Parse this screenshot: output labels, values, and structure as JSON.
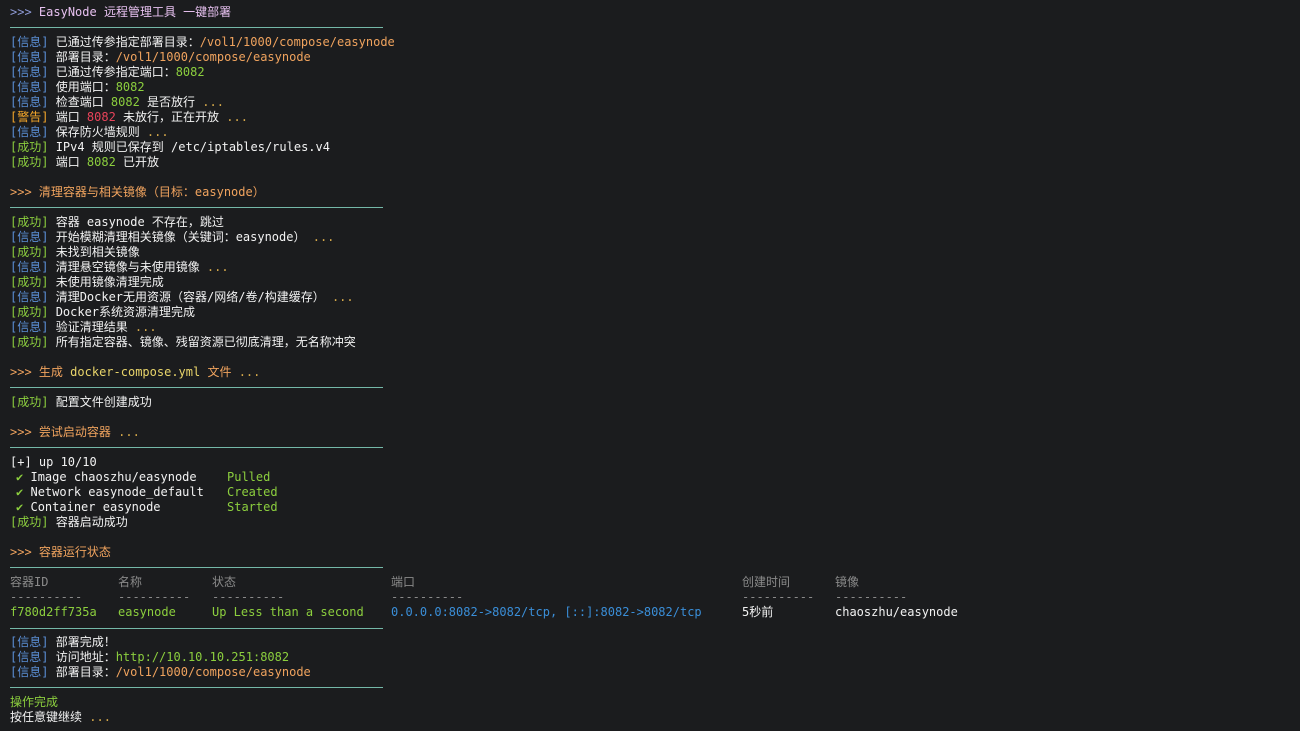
{
  "header": {
    "prompt": ">>>",
    "title": "EasyNode 远程管理工具 一键部署"
  },
  "tags": {
    "info": "[信息]",
    "warn": "[警告]",
    "ok": "[成功]"
  },
  "block1": [
    {
      "tag": "info",
      "pre": "已通过传参指定部署目录：",
      "val": "/vol1/1000/compose/easynode",
      "post": ""
    },
    {
      "tag": "info",
      "pre": "部署目录：",
      "val": "/vol1/1000/compose/easynode",
      "post": ""
    },
    {
      "tag": "info",
      "pre": "已通过传参指定端口：",
      "val": "8082",
      "post": ""
    },
    {
      "tag": "info",
      "pre": "使用端口：",
      "val": "8082",
      "post": ""
    },
    {
      "tag": "info",
      "pre": "检查端口 ",
      "val": "8082",
      "post": " 是否放行 ..."
    },
    {
      "tag": "warn",
      "pre": "端口 ",
      "val": "8082",
      "post": " 未放行，正在开放 ..."
    },
    {
      "tag": "info",
      "pre": "保存防火墙规则 ...",
      "val": "",
      "post": ""
    },
    {
      "tag": "ok",
      "pre": "IPv4 规则已保存到 /etc/iptables/rules.v4",
      "val": "",
      "post": ""
    },
    {
      "tag": "ok",
      "pre": "端口 ",
      "val": "8082",
      "post": " 已开放"
    }
  ],
  "section2": {
    "prompt": ">>>",
    "label": "清理容器与相关镜像（目标：easynode）"
  },
  "block2": [
    {
      "tag": "ok",
      "text": "容器 easynode 不存在，跳过"
    },
    {
      "tag": "info",
      "text": "开始模糊清理相关镜像（关键词：easynode）",
      "dots": " ..."
    },
    {
      "tag": "ok",
      "text": "未找到相关镜像"
    },
    {
      "tag": "info",
      "text": "清理悬空镜像与未使用镜像",
      "dots": " ..."
    },
    {
      "tag": "ok",
      "text": "未使用镜像清理完成"
    },
    {
      "tag": "info",
      "text": "清理Docker无用资源（容器/网络/卷/构建缓存）",
      "dots": " ..."
    },
    {
      "tag": "ok",
      "text": "Docker系统资源清理完成"
    },
    {
      "tag": "info",
      "text": "验证清理结果",
      "dots": " ..."
    },
    {
      "tag": "ok",
      "text": "所有指定容器、镜像、残留资源已彻底清理，无名称冲突"
    }
  ],
  "section3": {
    "prompt": ">>>",
    "label": "生成",
    "file": "docker-compose.yml",
    "suffix": "文件",
    "dots": "..."
  },
  "block3": {
    "tag": "ok",
    "text": "配置文件创建成功"
  },
  "section4": {
    "prompt": ">>>",
    "label": "尝试启动容器",
    "dots": "..."
  },
  "compose": {
    "summary": "[+] up 10/10",
    "items": [
      {
        "check": "✔",
        "name": "Image chaoszhu/easynode",
        "status": "Pulled"
      },
      {
        "check": "✔",
        "name": "Network easynode_default",
        "status": "Created"
      },
      {
        "check": "✔",
        "name": "Container easynode",
        "status": "Started"
      }
    ],
    "result_tag": "[成功]",
    "result": "容器启动成功"
  },
  "section5": {
    "prompt": ">>>",
    "label": "容器运行状态"
  },
  "table": {
    "headers": [
      "容器ID",
      "名称",
      "状态",
      "端口",
      "创建时间",
      "镜像"
    ],
    "dashes": [
      "----------",
      "----------",
      "----------",
      "----------",
      "----------",
      "----------"
    ],
    "row": [
      "f780d2ff735a",
      "easynode",
      "Up Less than a second",
      "0.0.0.0:8082->8082/tcp, [::]:8082->8082/tcp",
      "5秒前",
      "chaoszhu/easynode"
    ]
  },
  "block6": [
    {
      "tag": "info",
      "pre": "部署完成！",
      "val": "",
      "kind": ""
    },
    {
      "tag": "info",
      "pre": "访问地址：",
      "val": "http://10.10.10.251:8082",
      "kind": "url"
    },
    {
      "tag": "info",
      "pre": "部署目录：",
      "val": "/vol1/1000/compose/easynode",
      "kind": "path"
    }
  ],
  "footer": {
    "done": "操作完成",
    "continue": "按任意键继续",
    "dots": "..."
  }
}
